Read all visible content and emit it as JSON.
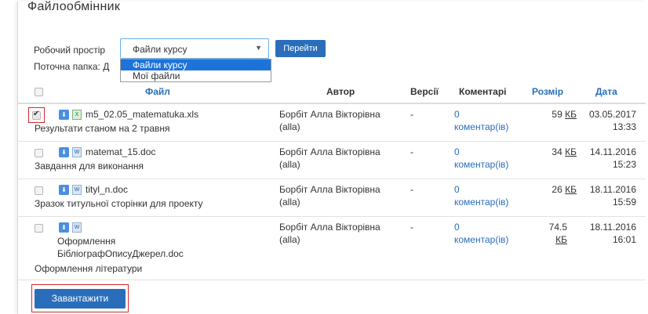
{
  "page": {
    "title": "Файлообмінник",
    "workspace_label": "Робочий простір",
    "workspace_selected": "Файли курсу",
    "go_button": "Перейти",
    "folder_label": "Поточна папка: Д",
    "workspace_options": [
      "Файли курсу",
      "Мої файли"
    ],
    "upload_button": "Завантажити"
  },
  "table": {
    "headers": {
      "file": "Файл",
      "author": "Автор",
      "versions": "Версії",
      "comments": "Коментарі",
      "size": "Розмір",
      "date": "Дата"
    },
    "rows": [
      {
        "file_name": "m5_02.05_matematuka.xls",
        "file_type": "xls",
        "description": "Результати станом на 2 травня",
        "author": "Борбіт Алла Вікторівна",
        "author_login": "(alla)",
        "versions": "-",
        "comment_count": "0",
        "comment_label": "коментар(ів)",
        "size_value": "59",
        "size_unit": "КБ",
        "date": "03.05.2017",
        "time": "13:33",
        "checked": true
      },
      {
        "file_name": "matemat_15.doc",
        "file_type": "doc",
        "description": "Завдання для виконання",
        "author": "Борбіт Алла Вікторівна",
        "author_login": "(alla)",
        "versions": "-",
        "comment_count": "0",
        "comment_label": "коментар(ів)",
        "size_value": "34",
        "size_unit": "КБ",
        "date": "14.11.2016",
        "time": "15:23",
        "checked": false
      },
      {
        "file_name": "tityl_n.doc",
        "file_type": "doc",
        "description": "Зразок титульної сторінки для проекту",
        "author": "Борбіт Алла Вікторівна",
        "author_login": "(alla)",
        "versions": "-",
        "comment_count": "0",
        "comment_label": "коментар(ів)",
        "size_value": "26",
        "size_unit": "КБ",
        "date": "18.11.2016",
        "time": "15:59",
        "checked": false
      },
      {
        "file_name_line1": "Оформлення",
        "file_name_line2": "БібліографОписуДжерел.doc",
        "file_type": "doc",
        "description": "Оформлення літератури",
        "author": "Борбіт Алла Вікторівна",
        "author_login": "(alla)",
        "versions": "-",
        "comment_count": "0",
        "comment_label": "коментар(ів)",
        "size_value": "74.5",
        "size_unit": "КБ",
        "date": "18.11.2016",
        "time": "16:01",
        "checked": false
      }
    ]
  },
  "icons": {
    "download": "download-icon",
    "doc": "word-doc-icon",
    "xls": "excel-xls-icon"
  },
  "colors": {
    "accent": "#2a6ebb",
    "highlight": "#d9262c"
  }
}
